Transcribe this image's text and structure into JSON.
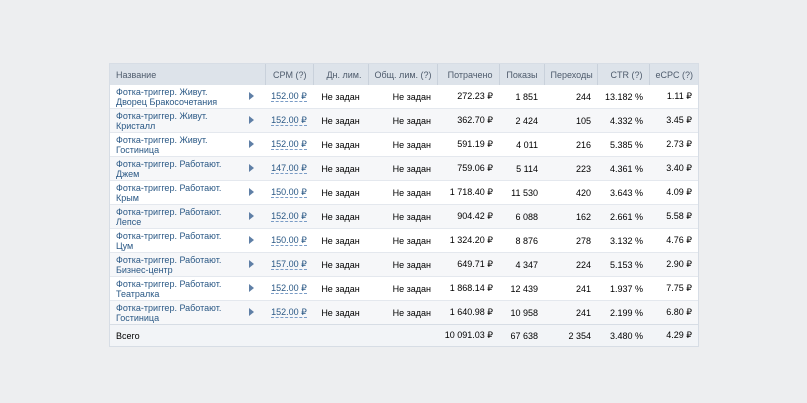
{
  "table": {
    "headers": {
      "name": "Название",
      "cpm": "CPM (?)",
      "day_limit": "Дн. лим.",
      "total_limit": "Общ. лим. (?)",
      "spent": "Потрачено",
      "impressions": "Показы",
      "clicks": "Переходы",
      "ctr": "CTR (?)",
      "ecpc": "eCPC (?)"
    },
    "rows": [
      {
        "name1": "Фотка-триггер. Живут.",
        "name2": "Дворец Бракосочетания",
        "cpm": "152.00 ₽",
        "day_limit": "Не задан",
        "total_limit": "Не задан",
        "spent": "272.23 ₽",
        "impressions": "1 851",
        "clicks": "244",
        "ctr": "13.182 %",
        "ecpc": "1.11 ₽"
      },
      {
        "name1": "Фотка-триггер. Живут.",
        "name2": "Кристалл",
        "cpm": "152.00 ₽",
        "day_limit": "Не задан",
        "total_limit": "Не задан",
        "spent": "362.70 ₽",
        "impressions": "2 424",
        "clicks": "105",
        "ctr": "4.332 %",
        "ecpc": "3.45 ₽"
      },
      {
        "name1": "Фотка-триггер. Живут.",
        "name2": "Гостиница",
        "cpm": "152.00 ₽",
        "day_limit": "Не задан",
        "total_limit": "Не задан",
        "spent": "591.19 ₽",
        "impressions": "4 011",
        "clicks": "216",
        "ctr": "5.385 %",
        "ecpc": "2.73 ₽"
      },
      {
        "name1": "Фотка-триггер. Работают.",
        "name2": "Джем",
        "cpm": "147.00 ₽",
        "day_limit": "Не задан",
        "total_limit": "Не задан",
        "spent": "759.06 ₽",
        "impressions": "5 114",
        "clicks": "223",
        "ctr": "4.361 %",
        "ecpc": "3.40 ₽"
      },
      {
        "name1": "Фотка-триггер. Работают.",
        "name2": "Крым",
        "cpm": "150.00 ₽",
        "day_limit": "Не задан",
        "total_limit": "Не задан",
        "spent": "1 718.40 ₽",
        "impressions": "11 530",
        "clicks": "420",
        "ctr": "3.643 %",
        "ecpc": "4.09 ₽"
      },
      {
        "name1": "Фотка-триггер. Работают.",
        "name2": "Лепсе",
        "cpm": "152.00 ₽",
        "day_limit": "Не задан",
        "total_limit": "Не задан",
        "spent": "904.42 ₽",
        "impressions": "6 088",
        "clicks": "162",
        "ctr": "2.661 %",
        "ecpc": "5.58 ₽"
      },
      {
        "name1": "Фотка-триггер. Работают.",
        "name2": "Цум",
        "cpm": "150.00 ₽",
        "day_limit": "Не задан",
        "total_limit": "Не задан",
        "spent": "1 324.20 ₽",
        "impressions": "8 876",
        "clicks": "278",
        "ctr": "3.132 %",
        "ecpc": "4.76 ₽"
      },
      {
        "name1": "Фотка-триггер. Работают.",
        "name2": "Бизнес-центр",
        "cpm": "157.00 ₽",
        "day_limit": "Не задан",
        "total_limit": "Не задан",
        "spent": "649.71 ₽",
        "impressions": "4 347",
        "clicks": "224",
        "ctr": "5.153 %",
        "ecpc": "2.90 ₽"
      },
      {
        "name1": "Фотка-триггер. Работают.",
        "name2": "Театралка",
        "cpm": "152.00 ₽",
        "day_limit": "Не задан",
        "total_limit": "Не задан",
        "spent": "1 868.14 ₽",
        "impressions": "12 439",
        "clicks": "241",
        "ctr": "1.937 %",
        "ecpc": "7.75 ₽"
      },
      {
        "name1": "Фотка-триггер. Работают.",
        "name2": "Гостиница",
        "cpm": "152.00 ₽",
        "day_limit": "Не задан",
        "total_limit": "Не задан",
        "spent": "1 640.98 ₽",
        "impressions": "10 958",
        "clicks": "241",
        "ctr": "2.199 %",
        "ecpc": "6.80 ₽"
      }
    ],
    "totals": {
      "label": "Всего",
      "spent": "10 091.03 ₽",
      "impressions": "67 638",
      "clicks": "2 354",
      "ctr": "3.480 %",
      "ecpc": "4.29 ₽"
    }
  },
  "colors": {
    "background": "#edeef0",
    "header_bg": "#dde3ea",
    "link": "#2a5885"
  },
  "icons": {
    "row_expand": "triangle-right-icon"
  }
}
